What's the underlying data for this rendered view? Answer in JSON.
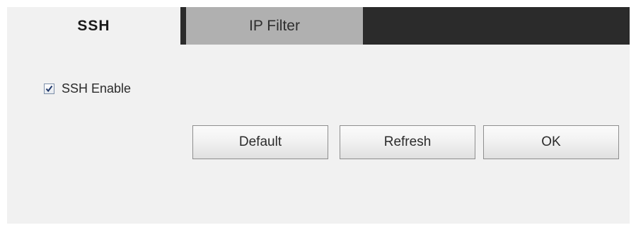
{
  "tabs": [
    {
      "label": "SSH",
      "active": true
    },
    {
      "label": "IP Filter",
      "active": false
    }
  ],
  "ssh_enable": {
    "label": "SSH Enable",
    "checked": true
  },
  "buttons": {
    "default_label": "Default",
    "refresh_label": "Refresh",
    "ok_label": "OK"
  },
  "colors": {
    "tab_bar": "#2b2b2b",
    "active_tab": "#f1f1f1",
    "inactive_tab": "#b0b0b0",
    "panel_background": "#f1f1f1"
  }
}
